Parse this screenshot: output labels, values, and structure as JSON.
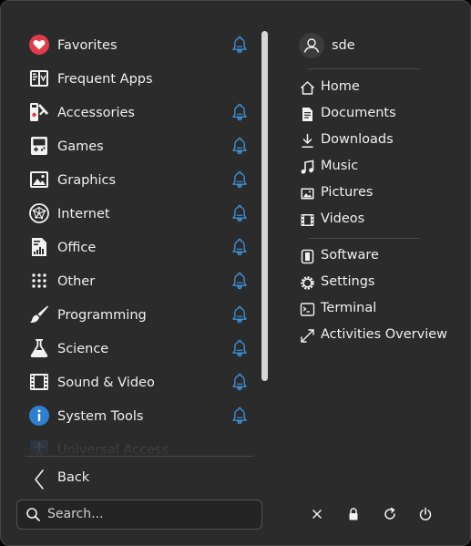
{
  "categories": [
    {
      "label": "Favorites",
      "icon": "heart-icon",
      "pin": true
    },
    {
      "label": "Frequent Apps",
      "icon": "frequent-apps-icon",
      "pin": false
    },
    {
      "label": "Accessories",
      "icon": "accessories-icon",
      "pin": true
    },
    {
      "label": "Games",
      "icon": "gamepad-icon",
      "pin": true
    },
    {
      "label": "Graphics",
      "icon": "image-icon",
      "pin": true
    },
    {
      "label": "Internet",
      "icon": "globe-icon",
      "pin": true
    },
    {
      "label": "Office",
      "icon": "office-document-icon",
      "pin": true
    },
    {
      "label": "Other",
      "icon": "grid-dots-icon",
      "pin": true
    },
    {
      "label": "Programming",
      "icon": "brush-icon",
      "pin": true
    },
    {
      "label": "Science",
      "icon": "flask-icon",
      "pin": true
    },
    {
      "label": "Sound & Video",
      "icon": "film-strip-icon",
      "pin": true
    },
    {
      "label": "System Tools",
      "icon": "info-icon",
      "pin": true
    },
    {
      "label": "Universal Access",
      "icon": "accessibility-icon",
      "pin": false
    }
  ],
  "back_label": "Back",
  "search": {
    "placeholder": "Search..."
  },
  "user": {
    "name": "sde"
  },
  "places": [
    {
      "label": "Home",
      "icon": "home-icon"
    },
    {
      "label": "Documents",
      "icon": "document-icon"
    },
    {
      "label": "Downloads",
      "icon": "download-icon"
    },
    {
      "label": "Music",
      "icon": "music-note-icon"
    },
    {
      "label": "Pictures",
      "icon": "picture-icon"
    },
    {
      "label": "Videos",
      "icon": "video-icon"
    }
  ],
  "system": [
    {
      "label": "Software",
      "icon": "software-icon"
    },
    {
      "label": "Settings",
      "icon": "gear-icon"
    },
    {
      "label": "Terminal",
      "icon": "terminal-icon"
    },
    {
      "label": "Activities Overview",
      "icon": "expand-icon"
    }
  ],
  "colors": {
    "background": "#2b2b2b",
    "pin_blue": "#3d8fd6",
    "heart_red": "#e03c4a",
    "info_blue": "#2f7fd0",
    "text": "#f0f0f0"
  }
}
